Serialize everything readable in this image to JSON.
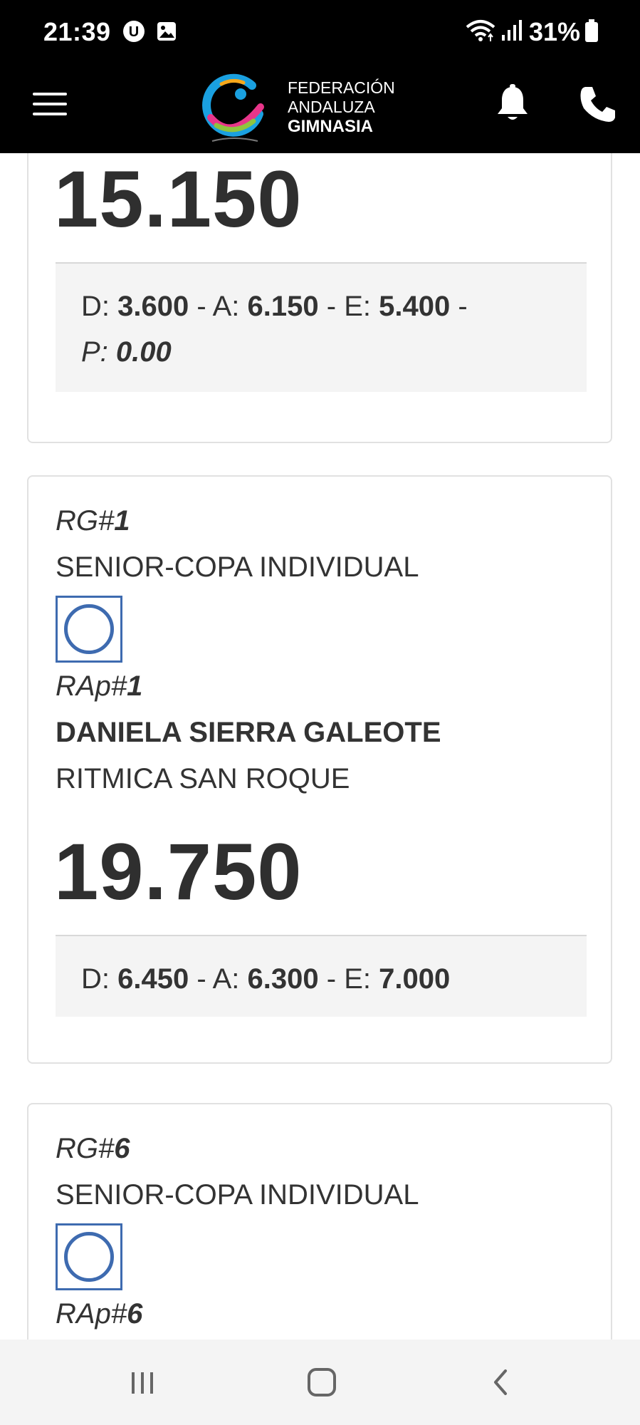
{
  "status_bar": {
    "time": "21:39",
    "battery": "31%",
    "icons": [
      "u-badge-icon",
      "gallery-icon",
      "wifi-icon",
      "signal-icon",
      "battery-icon"
    ]
  },
  "header": {
    "logo_line1": "FEDERACIÓN",
    "logo_line2": "ANDALUZA",
    "logo_line3": "GIMNASIA",
    "icons": [
      "menu-icon",
      "bell-icon",
      "phone-icon"
    ]
  },
  "results": [
    {
      "score": "15.150",
      "d_label": "D:",
      "d": "3.600",
      "a_label": "A:",
      "a": "6.150",
      "e_label": "E:",
      "e": "5.400",
      "p_label": "P:",
      "p": "0.00",
      "sep": "-"
    },
    {
      "rg_prefix": "RG#",
      "rg_num": "1",
      "category": "SENIOR-COPA INDIVIDUAL",
      "apparatus_icon": "hoop-icon",
      "rap_prefix": "RAp#",
      "rap_num": "1",
      "gymnast": "DANIELA SIERRA GALEOTE",
      "club": "RITMICA SAN ROQUE",
      "score": "19.750",
      "d_label": "D:",
      "d": "6.450",
      "a_label": "A:",
      "a": "6.300",
      "e_label": "E:",
      "e": "7.000",
      "sep": "-"
    },
    {
      "rg_prefix": "RG#",
      "rg_num": "6",
      "category": "SENIOR-COPA INDIVIDUAL",
      "apparatus_icon": "hoop-icon",
      "rap_prefix": "RAp#",
      "rap_num": "6"
    }
  ],
  "colors": {
    "header_bg": "#000000",
    "apparatus_blue": "#3e6bb0",
    "breakdown_bg": "#f4f4f4",
    "nav_bg": "#f4f4f4"
  },
  "nav_bar": {
    "icons": [
      "recent-apps-icon",
      "home-icon",
      "back-icon"
    ]
  }
}
